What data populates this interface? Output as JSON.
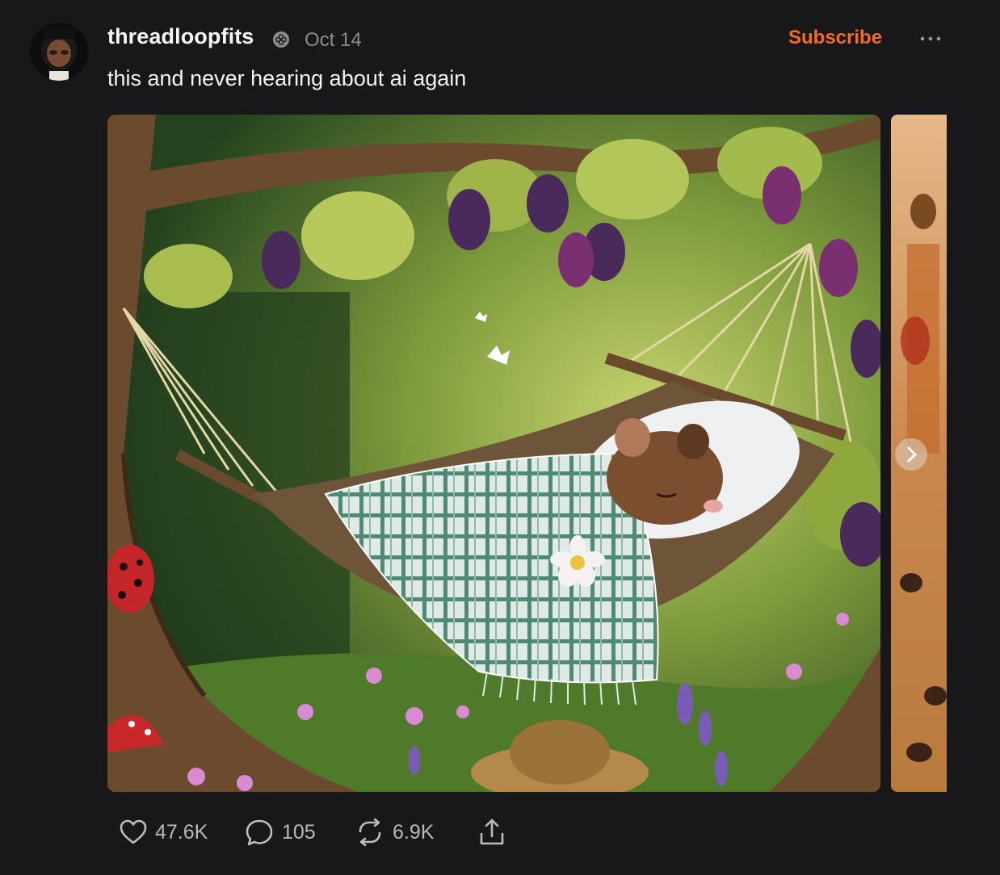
{
  "post": {
    "author": "threadloopfits",
    "date": "Oct 14",
    "subscribe_label": "Subscribe",
    "text": "this and never hearing about ai again"
  },
  "icons": {
    "verified": "flower-badge-icon",
    "more": "more-dots-icon",
    "like": "heart-icon",
    "comment": "comment-bubble-icon",
    "repost": "repost-arrows-icon",
    "share": "share-icon",
    "next": "chevron-right-icon"
  },
  "stats": {
    "likes": "47.6K",
    "comments": "105",
    "reposts": "6.9K"
  },
  "colors": {
    "accent": "#f96a1f",
    "background": "#18181a",
    "muted": "#8d8d8d"
  }
}
